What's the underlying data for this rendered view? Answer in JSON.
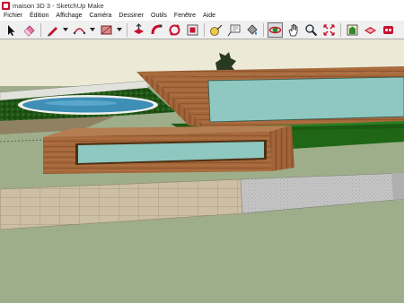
{
  "window": {
    "title": "maison 3D 3 - SketchUp Make"
  },
  "menu": {
    "items": [
      "Fichier",
      "Édition",
      "Affichage",
      "Caméra",
      "Dessiner",
      "Outils",
      "Fenêtre",
      "Aide"
    ]
  },
  "toolbar": {
    "tools": [
      "select-icon",
      "eraser-icon",
      "pencil-icon",
      "arc-icon",
      "rectangle-icon",
      "push-pull-icon",
      "follow-me-icon",
      "rotate-icon",
      "offset-icon",
      "tape-measure-icon",
      "text-icon",
      "paint-bucket-icon",
      "orbit-icon",
      "pan-icon",
      "zoom-icon",
      "zoom-extents-icon",
      "components-icon",
      "warehouse-icon",
      "extension-warehouse-icon"
    ],
    "active_tool": "orbit-icon"
  },
  "colors": {
    "sky": "#ecead7",
    "ground": "#9eae8a",
    "wood": "#a4673a",
    "glass": "#8ec8c0",
    "lawn": "#1a5a12",
    "pool_water": "#3e8fb6",
    "paving": "#cdbfa4",
    "stone_patio": "#c4c4c4"
  }
}
